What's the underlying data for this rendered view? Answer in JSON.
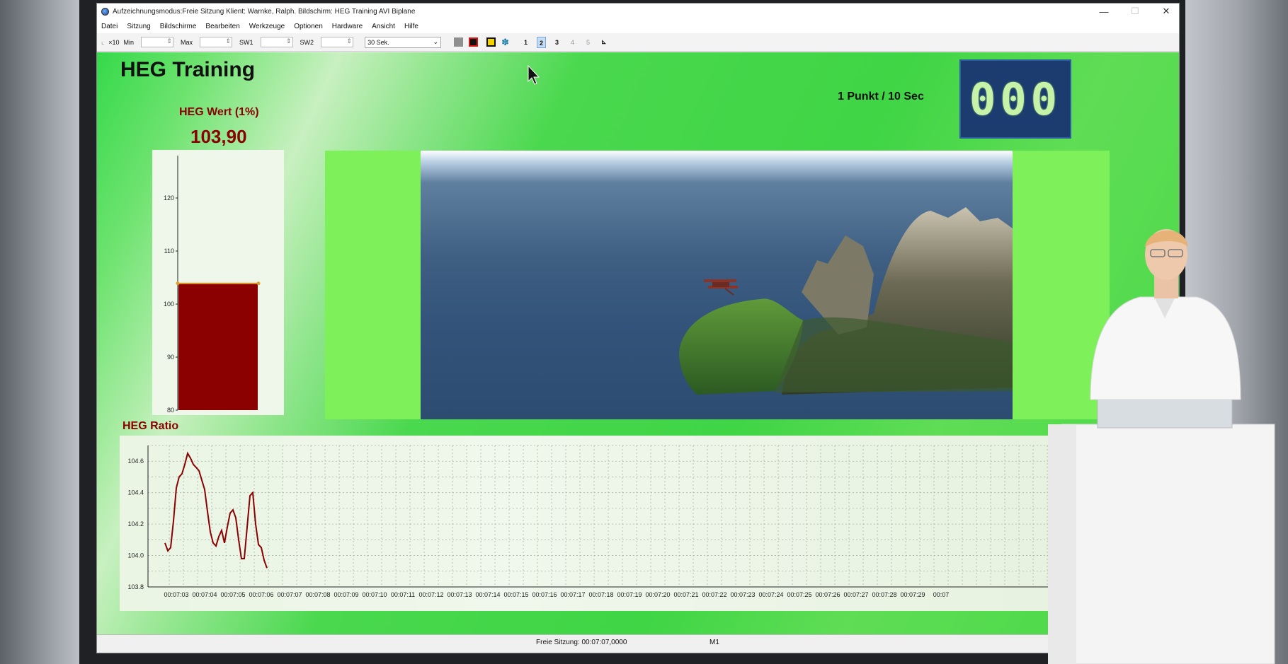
{
  "window": {
    "title": "Aufzeichnungsmodus:Freie Sitzung  Klient: Warnke, Ralph. Bildschirm: HEG Training AVI Biplane",
    "controls": {
      "minimize": "—",
      "maximize": "☐",
      "close": "✕"
    }
  },
  "menu": [
    "Datei",
    "Sitzung",
    "Bildschirme",
    "Bearbeiten",
    "Werkzeuge",
    "Optionen",
    "Hardware",
    "Ansicht",
    "Hilfe"
  ],
  "toolbar": {
    "x10": "×10",
    "min_label": "Min",
    "max_label": "Max",
    "sw1_label": "SW1",
    "sw2_label": "SW2",
    "interval_value": "30 Sek.",
    "screens": [
      "1",
      "2",
      "3",
      "4",
      "5"
    ],
    "active_screen": "2"
  },
  "screen": {
    "title": "HEG Training",
    "rate_label": "1 Punkt / 10 Sec",
    "counter": "000",
    "heg_wert_label": "HEG Wert (1%)",
    "heg_wert_value": "103,90",
    "heg_ratio_label": "HEG Ratio"
  },
  "colors": {
    "bar": "#8b0000",
    "background_green": "#3fd545",
    "counter_bg": "#1c3c6f",
    "line": "#8b0000"
  },
  "chart_data": [
    {
      "type": "bar",
      "title": "HEG Wert (1%)",
      "categories": [
        ""
      ],
      "values": [
        103.9
      ],
      "ylim": [
        80,
        128
      ],
      "yticks": [
        "80",
        "90",
        "100",
        "110",
        "120"
      ],
      "grid": false
    },
    {
      "type": "line",
      "title": "HEG Ratio",
      "ylim": [
        103.8,
        104.7
      ],
      "yticks": [
        "103.8",
        "104.0",
        "104.2",
        "104.4",
        "104.6"
      ],
      "xticks": [
        "00:07:03",
        "00:07:04",
        "00:07:05",
        "00:07:06",
        "00:07:07",
        "00:07:08",
        "00:07:09",
        "00:07:10",
        "00:07:11",
        "00:07:12",
        "00:07:13",
        "00:07:14",
        "00:07:15",
        "00:07:16",
        "00:07:17",
        "00:07:18",
        "00:07:19",
        "00:07:20",
        "00:07:21",
        "00:07:22",
        "00:07:23",
        "00:07:24",
        "00:07:25",
        "00:07:26",
        "00:07:27",
        "00:07:28",
        "00:07:29",
        "00:07"
      ],
      "grid": true,
      "series": [
        {
          "x": [
            2.6,
            2.7,
            2.8,
            2.9,
            3.0,
            3.1,
            3.2,
            3.3,
            3.4,
            3.5,
            3.6,
            3.7,
            3.8,
            3.9,
            4.0,
            4.1,
            4.2,
            4.3,
            4.4,
            4.5,
            4.6,
            4.7,
            4.8,
            4.9,
            5.0,
            5.1,
            5.2,
            5.3,
            5.4,
            5.5,
            5.6,
            5.7,
            5.8,
            5.9,
            6.0,
            6.1,
            6.2,
            6.3,
            6.4,
            6.5,
            6.6,
            6.7,
            6.8,
            6.9,
            7.0
          ],
          "values": [
            104.08,
            104.03,
            104.05,
            104.22,
            104.43,
            104.5,
            104.52,
            104.58,
            104.65,
            104.62,
            104.58,
            104.56,
            104.54,
            104.48,
            104.42,
            104.28,
            104.15,
            104.08,
            104.06,
            104.12,
            104.16,
            104.08,
            104.18,
            104.27,
            104.29,
            104.24,
            104.1,
            103.98,
            103.98,
            104.18,
            104.38,
            104.4,
            104.2,
            104.07,
            104.05,
            103.97,
            103.92,
            null,
            null,
            null,
            null,
            null,
            null,
            null,
            null
          ]
        }
      ]
    }
  ],
  "status": {
    "session": "Freie Sitzung: 00:07:07,0000",
    "mode": "M1"
  }
}
